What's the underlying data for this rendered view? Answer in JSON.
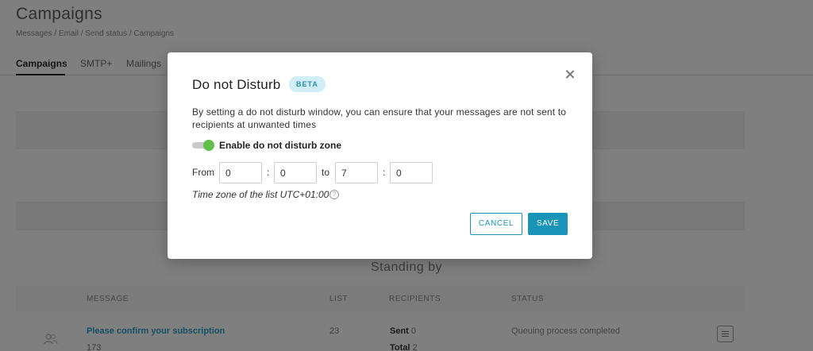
{
  "page": {
    "title": "Campaigns",
    "breadcrumb": "Messages / Email / Send status / Campaigns"
  },
  "tabs": [
    {
      "label": "Campaigns",
      "active": true
    },
    {
      "label": "SMTP+",
      "active": false
    },
    {
      "label": "Mailings",
      "active": false
    }
  ],
  "section": {
    "title": "Standing by"
  },
  "table": {
    "headers": [
      "MESSAGE",
      "LIST",
      "RECIPIENTS",
      "STATUS"
    ],
    "rows": [
      {
        "message": "Please confirm your subscription",
        "message_sub": "173",
        "list": "23",
        "sent_label": "Sent",
        "sent_value": "0",
        "total_label": "Total",
        "total_value": "2",
        "status": "Queuing process completed"
      }
    ]
  },
  "modal": {
    "title": "Do not Disturb",
    "badge": "BETA",
    "description": "By setting a do not disturb window, you can ensure that your messages are not sent to recipients at unwanted times",
    "toggle_label": "Enable do not disturb zone",
    "toggle_on": true,
    "from_label": "From",
    "to_label": "to",
    "separator": ":",
    "from_hour": "0",
    "from_minute": "0",
    "to_hour": "7",
    "to_minute": "0",
    "timezone_note": "Time zone of the list UTC+01:00",
    "cancel_label": "CANCEL",
    "save_label": "SAVE"
  },
  "colors": {
    "accent": "#1a93b8",
    "toggle_on": "#5fbf4a",
    "badge_bg": "#cfeef6"
  }
}
